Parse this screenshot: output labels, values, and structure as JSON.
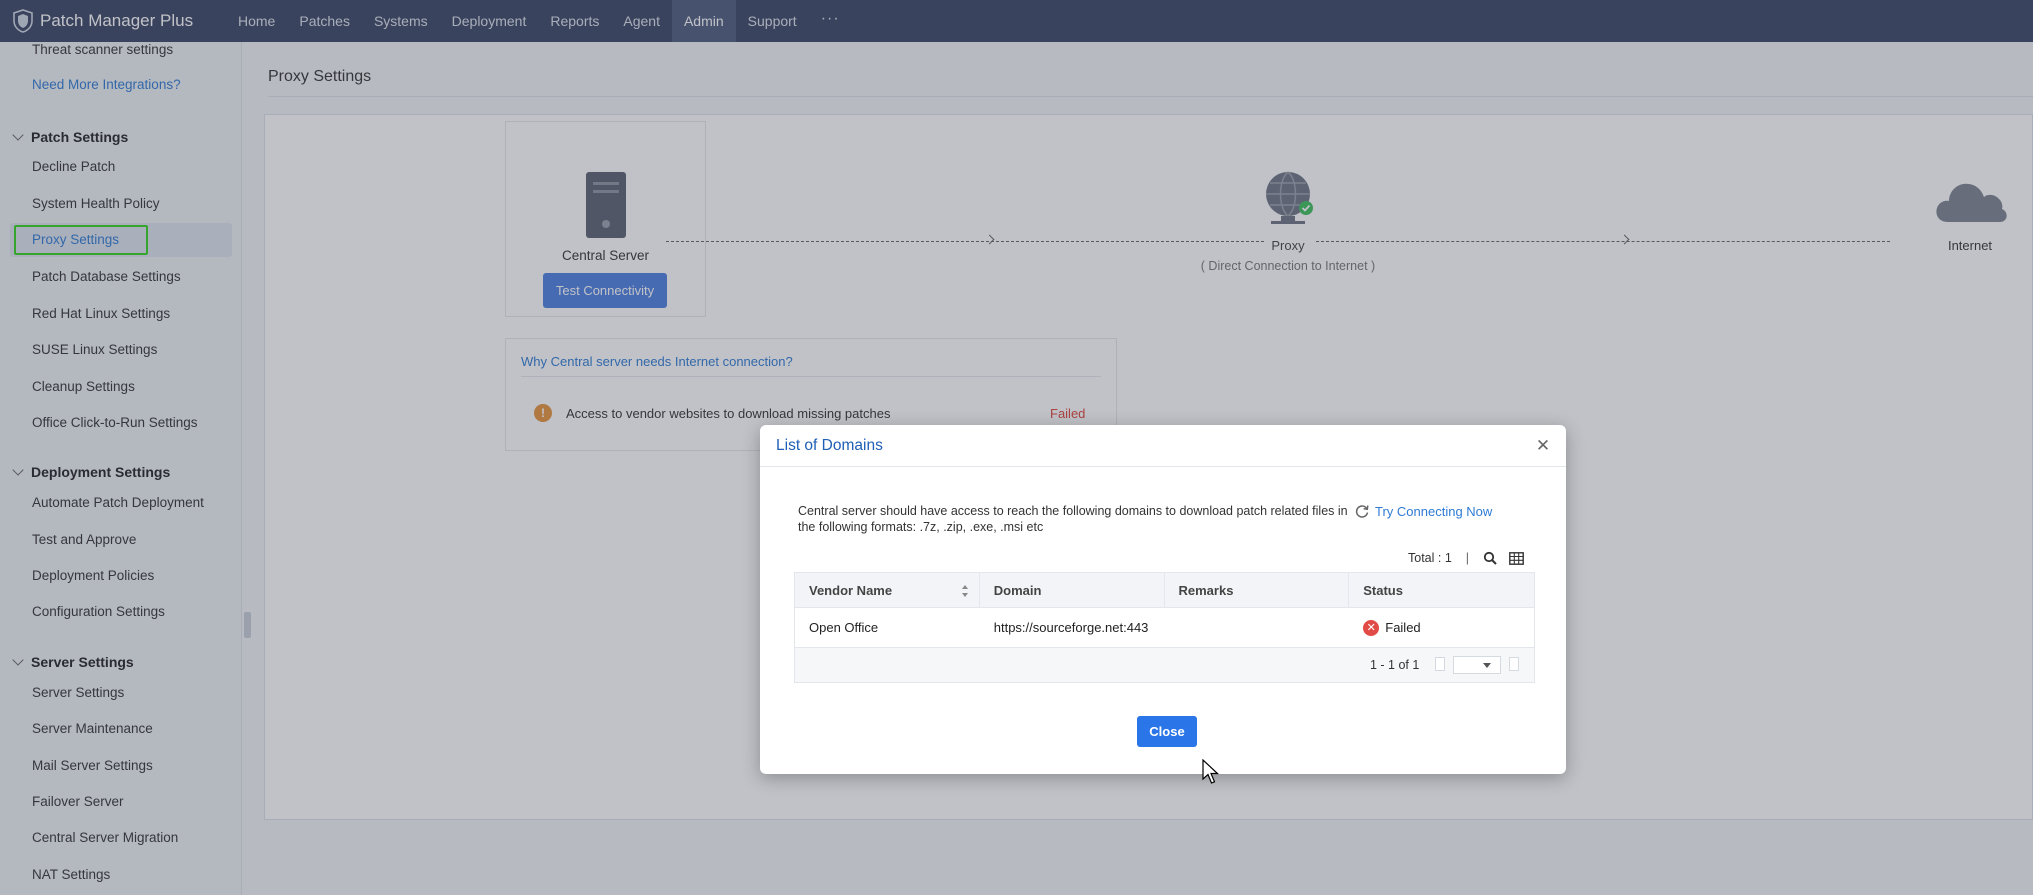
{
  "app": {
    "title": "Patch Manager Plus",
    "nav": [
      "Home",
      "Patches",
      "Systems",
      "Deployment",
      "Reports",
      "Agent",
      "Admin",
      "Support"
    ],
    "active_nav": "Admin",
    "more_label": "···"
  },
  "sidebar": {
    "top_links": [
      "Threat scanner settings",
      "Need More Integrations?"
    ],
    "groups": [
      {
        "title": "Patch Settings",
        "items": [
          "Decline Patch",
          "System Health Policy",
          "Proxy Settings",
          "Patch Database Settings",
          "Red Hat Linux Settings",
          "SUSE Linux Settings",
          "Cleanup Settings",
          "Office Click-to-Run Settings"
        ]
      },
      {
        "title": "Deployment Settings",
        "items": [
          "Automate Patch Deployment",
          "Test and Approve",
          "Deployment Policies",
          "Configuration Settings"
        ]
      },
      {
        "title": "Server Settings",
        "items": [
          "Server Settings",
          "Server Maintenance",
          "Mail Server Settings",
          "Failover Server",
          "Central Server Migration",
          "NAT Settings"
        ]
      }
    ],
    "active_item": "Proxy Settings"
  },
  "main": {
    "page_title": "Proxy Settings",
    "diagram": {
      "server_label": "Central Server",
      "test_button": "Test Connectivity",
      "proxy_label": "Proxy",
      "proxy_sub": "( Direct Connection to Internet )",
      "internet_label": "Internet"
    },
    "why_link": "Why Central server needs Internet connection?",
    "check_item": "Access to vendor websites to download missing patches",
    "check_status": "Failed"
  },
  "modal": {
    "title": "List of Domains",
    "description": "Central server should have access to reach the following domains to download patch related files in the following formats: .7z, .zip, .exe, .msi etc",
    "try_now": "Try Connecting Now",
    "total": "Total : 1",
    "columns": [
      "Vendor Name",
      "Domain",
      "Remarks",
      "Status"
    ],
    "rows": [
      {
        "vendor": "Open Office",
        "domain": "https://sourceforge.net:443",
        "remarks": "",
        "status": "Failed"
      }
    ],
    "pagination": "1 - 1 of 1",
    "close_button": "Close"
  },
  "colors": {
    "nav_bg": "#3a4563",
    "accent": "#2a76e8",
    "link": "#2f7bd4",
    "failed": "#e04b45",
    "highlight": "#33d51e"
  }
}
